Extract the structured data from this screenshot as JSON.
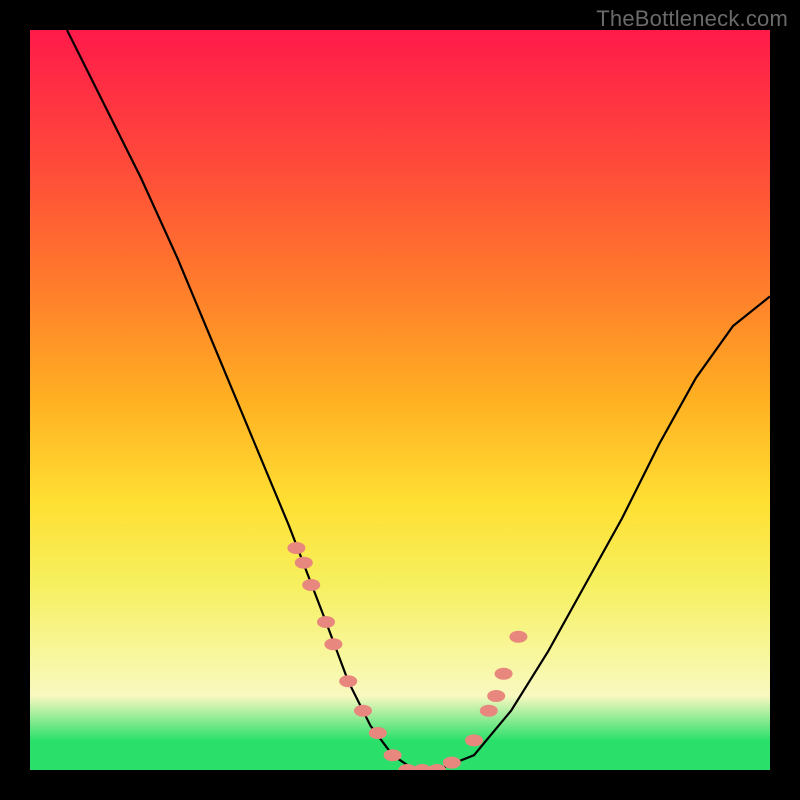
{
  "watermark": "TheBottleneck.com",
  "colors": {
    "background_frame": "#000000",
    "gradient_top": "#ff1a4a",
    "gradient_bottom": "#2be06a",
    "curve": "#000000",
    "markers": "#e8877d"
  },
  "chart_data": {
    "type": "line",
    "title": "",
    "xlabel": "",
    "ylabel": "",
    "xlim": [
      0,
      100
    ],
    "ylim": [
      0,
      100
    ],
    "grid": false,
    "series": [
      {
        "name": "bottleneck-curve",
        "x": [
          5,
          10,
          15,
          20,
          25,
          30,
          35,
          40,
          43,
          46,
          49,
          52,
          55,
          60,
          65,
          70,
          75,
          80,
          85,
          90,
          95,
          100
        ],
        "y": [
          100,
          90,
          80,
          69,
          57,
          45,
          33,
          20,
          12,
          6,
          2,
          0,
          0,
          2,
          8,
          16,
          25,
          34,
          44,
          53,
          60,
          64
        ]
      }
    ],
    "markers": {
      "name": "highlighted-points",
      "x": [
        36,
        37,
        38,
        40,
        41,
        43,
        45,
        47,
        49,
        51,
        53,
        55,
        57,
        60,
        62,
        63,
        64,
        66
      ],
      "y": [
        30,
        28,
        25,
        20,
        17,
        12,
        8,
        5,
        2,
        0,
        0,
        0,
        1,
        4,
        8,
        10,
        13,
        18
      ]
    },
    "annotations": []
  }
}
